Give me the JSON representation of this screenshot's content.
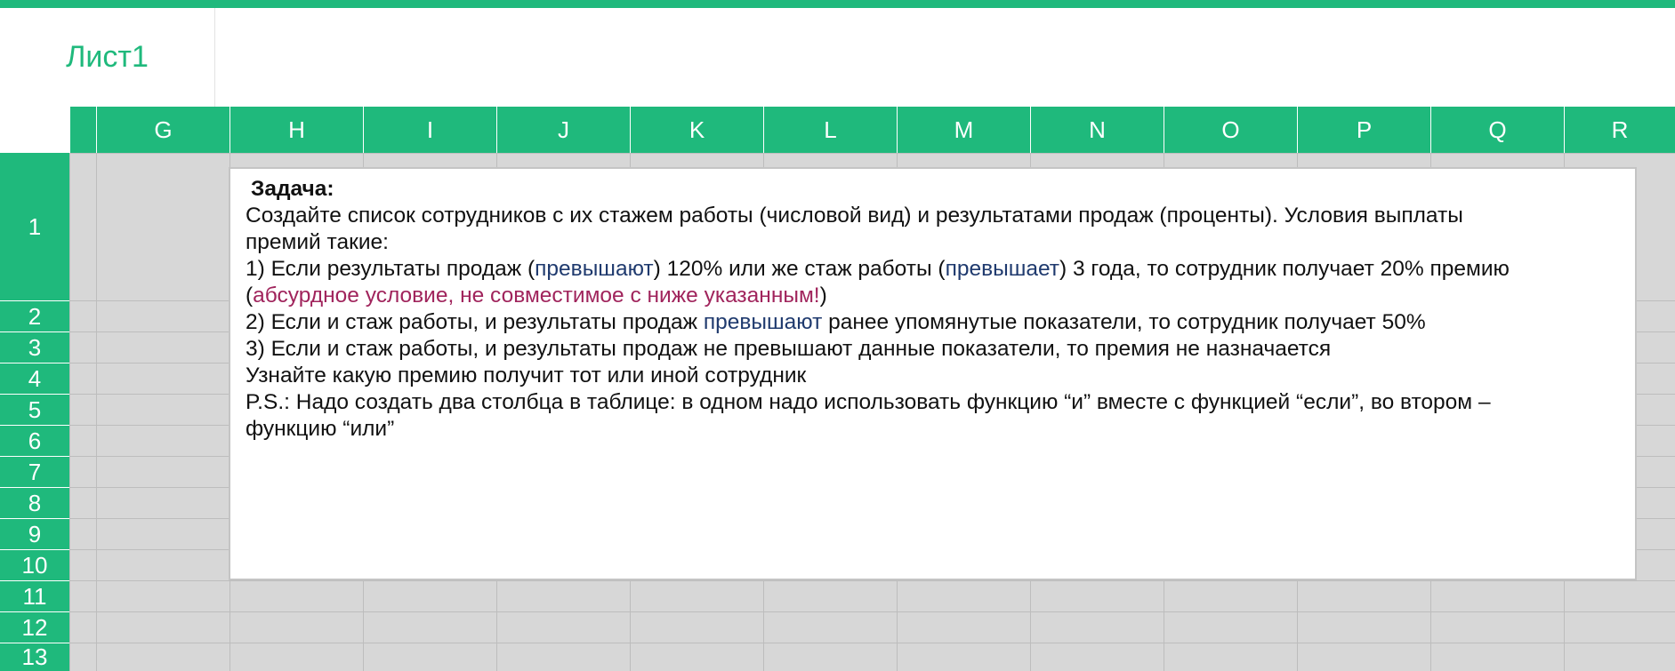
{
  "sheet_tab": {
    "label": "Лист1"
  },
  "columns": [
    "G",
    "H",
    "I",
    "J",
    "K",
    "L",
    "M",
    "N",
    "O",
    "P",
    "Q",
    "R"
  ],
  "rows": [
    "1",
    "2",
    "3",
    "4",
    "5",
    "6",
    "7",
    "8",
    "9",
    "10",
    "11",
    "12",
    "13"
  ],
  "textbox": {
    "title": "Задача:",
    "line1": "Создайте список сотрудников с их стажем работы (числовой вид) и результатами продаж (проценты). Условия выплаты",
    "line2": "премий такие:",
    "line3_a": "1) Если результаты продаж (",
    "line3_b": "превышают",
    "line3_c": ") 120% или же стаж работы (",
    "line3_d": "превышает",
    "line3_e": ") 3 года, то сотрудник получает 20% премию",
    "line4_a": "(",
    "line4_b": "абсурдное условие, не совместимое с ниже указанным!",
    "line4_c": ")",
    "line5_a": "2) Если и стаж работы, и результаты продаж ",
    "line5_b": "превышают",
    "line5_c": " ранее упомянутые показатели, то сотрудник получает 50%",
    "line6": "3) Если и стаж работы, и результаты продаж не превышают данные показатели, то премия не назначается",
    "line7": "Узнайте какую премию получит тот или иной сотрудник",
    "line8": "P.S.: Надо создать два столбца в таблице: в одном надо использовать функцию “и” вместе с функцией “если”, во втором –",
    "line9": "функцию “или”"
  },
  "colors": {
    "accent": "#1fb97c",
    "highlight_blue": "#1f3a6e",
    "highlight_purple": "#a0245c",
    "grid_bg": "#d7d7d7"
  }
}
